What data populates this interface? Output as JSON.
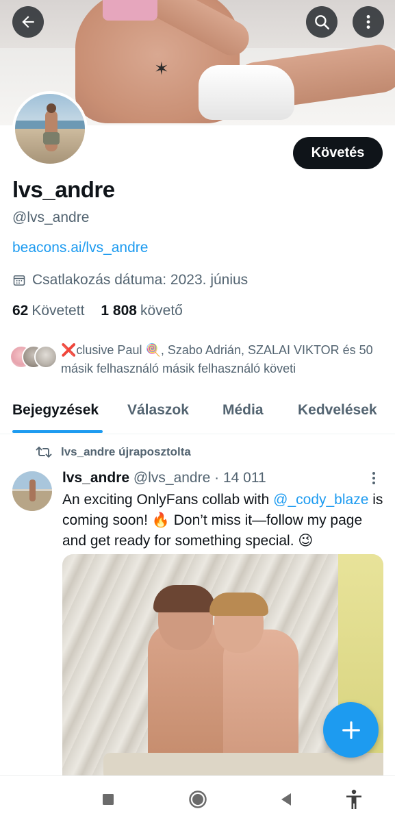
{
  "header": {
    "back_icon": "arrow-left-icon",
    "search_icon": "search-icon",
    "more_icon": "more-vertical-icon"
  },
  "profile": {
    "display_name": "lvs_andre",
    "handle": "@lvs_andre",
    "link": "beacons.ai/lvs_andre",
    "joined": "Csatlakozás dátuma: 2023. június",
    "following_count": "62",
    "following_label": "Követett",
    "followers_count": "1 808",
    "followers_label": "követő",
    "follow_button": "Követés",
    "known_followers": "❌clusive Paul 🍭, Szabo Adrián, SZALAI VIKTOR és 50 másik felhasználó másik felhasználó követi"
  },
  "tabs": [
    {
      "label": "Bejegyzések",
      "active": true
    },
    {
      "label": "Válaszok",
      "active": false
    },
    {
      "label": "Média",
      "active": false
    },
    {
      "label": "Kedvelések",
      "active": false
    }
  ],
  "post": {
    "repost_label": "lvs_andre újraposztolta",
    "author_name": "lvs_andre",
    "author_handle": "@lvs_andre",
    "separator": "·",
    "timestamp": "14 011",
    "text_before": "An exciting OnlyFans collab with ",
    "mention": "@_cody_blaze",
    "text_after": " is coming soon! 🔥 Don’t miss it—follow my page and get ready for something special. 😉"
  },
  "fab_icon": "plus-icon",
  "android_nav": {
    "recent_icon": "square-icon",
    "home_icon": "circle-home-icon",
    "back_icon": "triangle-back-icon",
    "accessibility_icon": "accessibility-icon"
  },
  "colors": {
    "accent": "#1d9bf0",
    "text_primary": "#0f1419",
    "text_secondary": "#536471",
    "follow_button_bg": "#0f1419"
  }
}
